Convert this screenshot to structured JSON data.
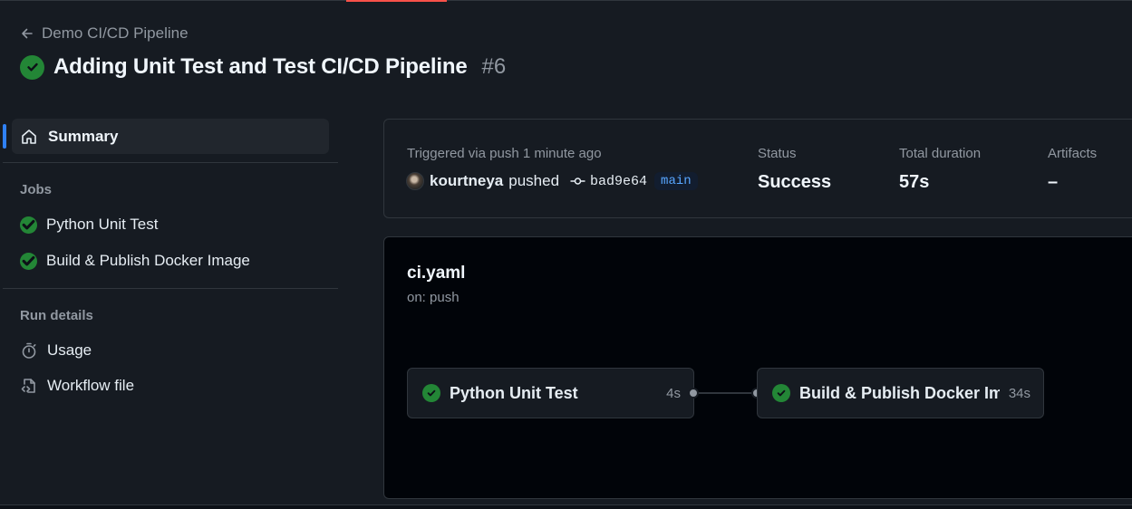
{
  "header": {
    "back_label": "Demo CI/CD Pipeline",
    "title": "Adding Unit Test and Test CI/CD Pipeline",
    "run_number": "#6"
  },
  "sidebar": {
    "summary_label": "Summary",
    "jobs_heading": "Jobs",
    "jobs": [
      {
        "label": "Python Unit Test",
        "status": "success"
      },
      {
        "label": "Build & Publish Docker Image",
        "status": "success"
      }
    ],
    "run_details_heading": "Run details",
    "run_details": [
      {
        "label": "Usage",
        "icon": "stopwatch-icon"
      },
      {
        "label": "Workflow file",
        "icon": "file-code-icon"
      }
    ]
  },
  "summary": {
    "trigger_text": "Triggered via push 1 minute ago",
    "actor": "kourtneya",
    "action": "pushed",
    "commit": "bad9e64",
    "branch": "main",
    "status_label": "Status",
    "status_value": "Success",
    "duration_label": "Total duration",
    "duration_value": "57s",
    "artifacts_label": "Artifacts",
    "artifacts_value": "–"
  },
  "workflow": {
    "file": "ci.yaml",
    "trigger": "on: push",
    "jobs": [
      {
        "name": "Python Unit Test",
        "duration": "4s"
      },
      {
        "name": "Build & Publish Docker Im...",
        "duration": "34s"
      }
    ]
  },
  "colors": {
    "success": "#238636",
    "accent": "#2f81f7",
    "progress": "#f85149"
  }
}
